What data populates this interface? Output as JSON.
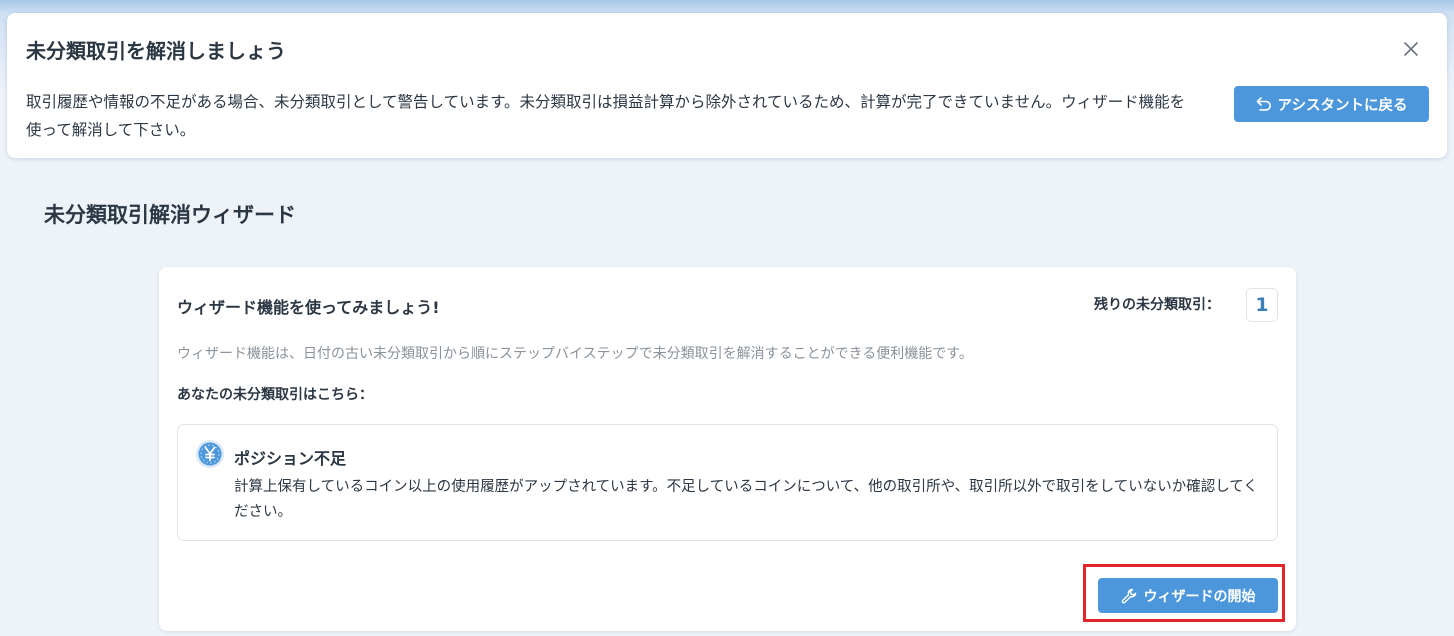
{
  "notice": {
    "title": "未分類取引を解消しましょう",
    "body": "取引履歴や情報の不足がある場合、未分類取引として警告しています。未分類取引は損益計算から除外されているため、計算が完了できていません。ウィザード機能を使って解消して下さい。",
    "assistant_button_label": "アシスタントに戻る",
    "close_icon": "close-icon",
    "back_icon": "undo-arrow-icon"
  },
  "page": {
    "title": "未分類取引解消ウィザード"
  },
  "card": {
    "title": "ウィザード機能を使ってみましょう!",
    "remaining_label": "残りの未分類取引：",
    "remaining_count": "1",
    "description": "ウィザード機能は、日付の古い未分類取引から順にステップバイステップで未分類取引を解消することができる便利機能です。",
    "list_heading": "あなたの未分類取引はこちら：",
    "issue": {
      "icon": "yen-coin-icon",
      "title": "ポジション不足",
      "body": "計算上保有しているコイン以上の使用履歴がアップされています。不足しているコインについて、他の取引所や、取引所以外で取引をしていないか確認してください。"
    },
    "start_button_label": "ウィザードの開始",
    "start_icon": "wrench-icon"
  },
  "colors": {
    "primary": "#4c97dc",
    "highlight": "#e0262c",
    "text": "#2c3744",
    "muted": "#8a929b",
    "background": "#eef2f9"
  }
}
